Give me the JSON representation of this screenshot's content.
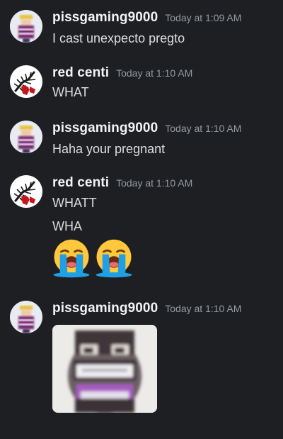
{
  "messages": [
    {
      "author": "pissgaming9000",
      "timestamp": "Today at 1:09 AM",
      "avatar_icon": "pixel-character-avatar-icon",
      "lines": [
        "I cast unexpecto pregto"
      ]
    },
    {
      "author": "red centi",
      "timestamp": "Today at 1:10 AM",
      "avatar_icon": "centipede-avatar-icon",
      "lines": [
        "WHAT"
      ]
    },
    {
      "author": "pissgaming9000",
      "timestamp": "Today at 1:10 AM",
      "avatar_icon": "pixel-character-avatar-icon",
      "lines": [
        "Haha your pregnant"
      ]
    },
    {
      "author": "red centi",
      "timestamp": "Today at 1:10 AM",
      "avatar_icon": "centipede-avatar-icon",
      "lines": [
        "WHATT",
        "WHA"
      ],
      "emojis": [
        "loudly-crying-face-emoji",
        "loudly-crying-face-emoji"
      ]
    },
    {
      "author": "pissgaming9000",
      "timestamp": "Today at 1:10 AM",
      "avatar_icon": "pixel-character-avatar-icon",
      "attachment": "blurry-laughing-face-image"
    }
  ],
  "colors": {
    "background": "#1e1f22",
    "username": "#f2f3f5",
    "timestamp": "#949ba4",
    "message_text": "#dbdee1"
  }
}
